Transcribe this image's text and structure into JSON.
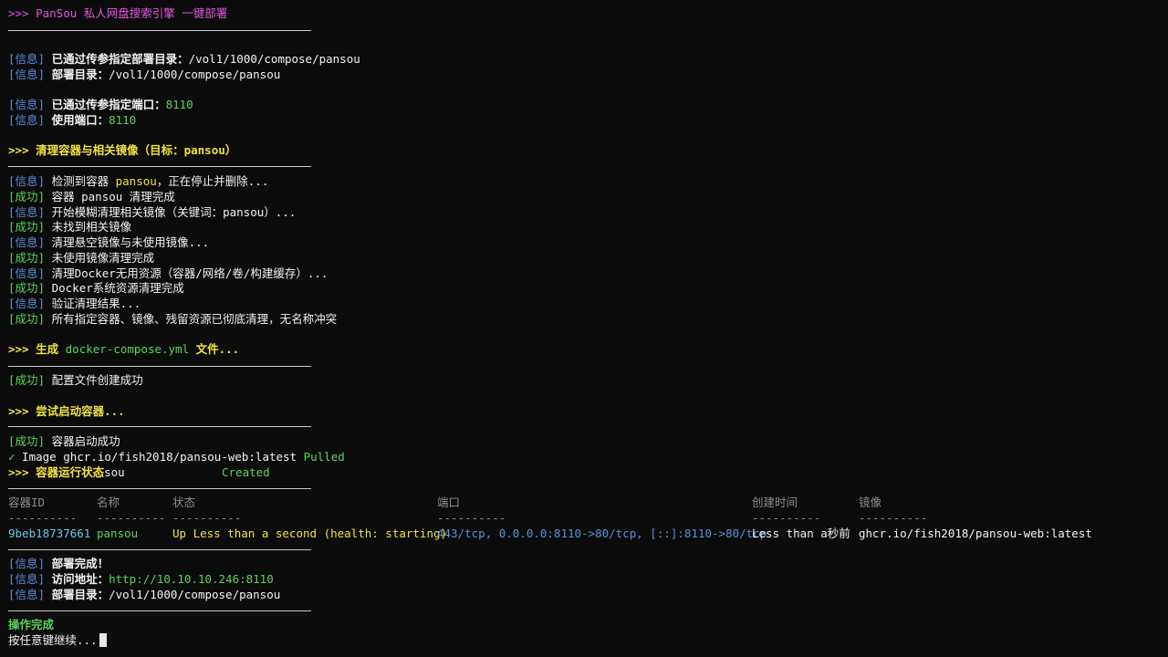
{
  "title": ">>> PanSou 私人网盘搜索引擎 一键部署",
  "tags": {
    "info": "[信息]",
    "ok": "[成功]"
  },
  "prompt": ">>> ",
  "block1": {
    "l1_text": "已通过传参指定部署目录：",
    "l1_val": "/vol1/1000/compose/pansou",
    "l2_text": "部署目录：",
    "l2_val": "/vol1/1000/compose/pansou",
    "l3_text": "已通过传参指定端口：",
    "l3_val": "8110",
    "l4_text": "使用端口：",
    "l4_val": "8110"
  },
  "cleanup": {
    "header": "清理容器与相关镜像（目标：pansou）",
    "l1_pre": "检测到容器 ",
    "l1_name": "pansou",
    "l1_post": "，正在停止并删除...",
    "l2": "容器 pansou 清理完成",
    "l3": "开始模糊清理相关镜像（关键词：pansou）...",
    "l4": "未找到相关镜像",
    "l5": "清理悬空镜像与未使用镜像...",
    "l6": "未使用镜像清理完成",
    "l7": "清理Docker无用资源（容器/网络/卷/构建缓存）...",
    "l8": "Docker系统资源清理完成",
    "l9": "验证清理结果...",
    "l10": "所有指定容器、镜像、残留资源已彻底清理，无名称冲突"
  },
  "compose": {
    "header_pre": "生成 ",
    "header_file": "docker-compose.yml",
    "header_post": " 文件...",
    "l1": "配置文件创建成功"
  },
  "start": {
    "header": "尝试启动容器...",
    "l1": "容器启动成功",
    "pull_check": "✓",
    "pull_image": " Image ghcr.io/fish2018/pansou-web:latest ",
    "pull_status": "Pulled",
    "status_header": "容器运行状态",
    "status_overlap": "sou",
    "status_created": "Created"
  },
  "table": {
    "headers": [
      "容器ID",
      "名称",
      "状态",
      "端口",
      "创建时间",
      "镜像"
    ],
    "dashes": "----------",
    "row": {
      "id": "9beb18737661",
      "name": "pansou",
      "status": "Up Less than a second (health: starting)",
      "ports": "443/tcp, 0.0.0.0:8110->80/tcp, [::]:8110->80/tcp",
      "created": "Less than a秒前",
      "image": "ghcr.io/fish2018/pansou-web:latest"
    }
  },
  "final": {
    "l1": "部署完成！",
    "l2_text": "访问地址：",
    "l2_val": "http://10.10.10.246:8110",
    "l3_text": "部署目录：",
    "l3_val": "/vol1/1000/compose/pansou"
  },
  "done": "操作完成",
  "press_key": "按任意键继续..."
}
